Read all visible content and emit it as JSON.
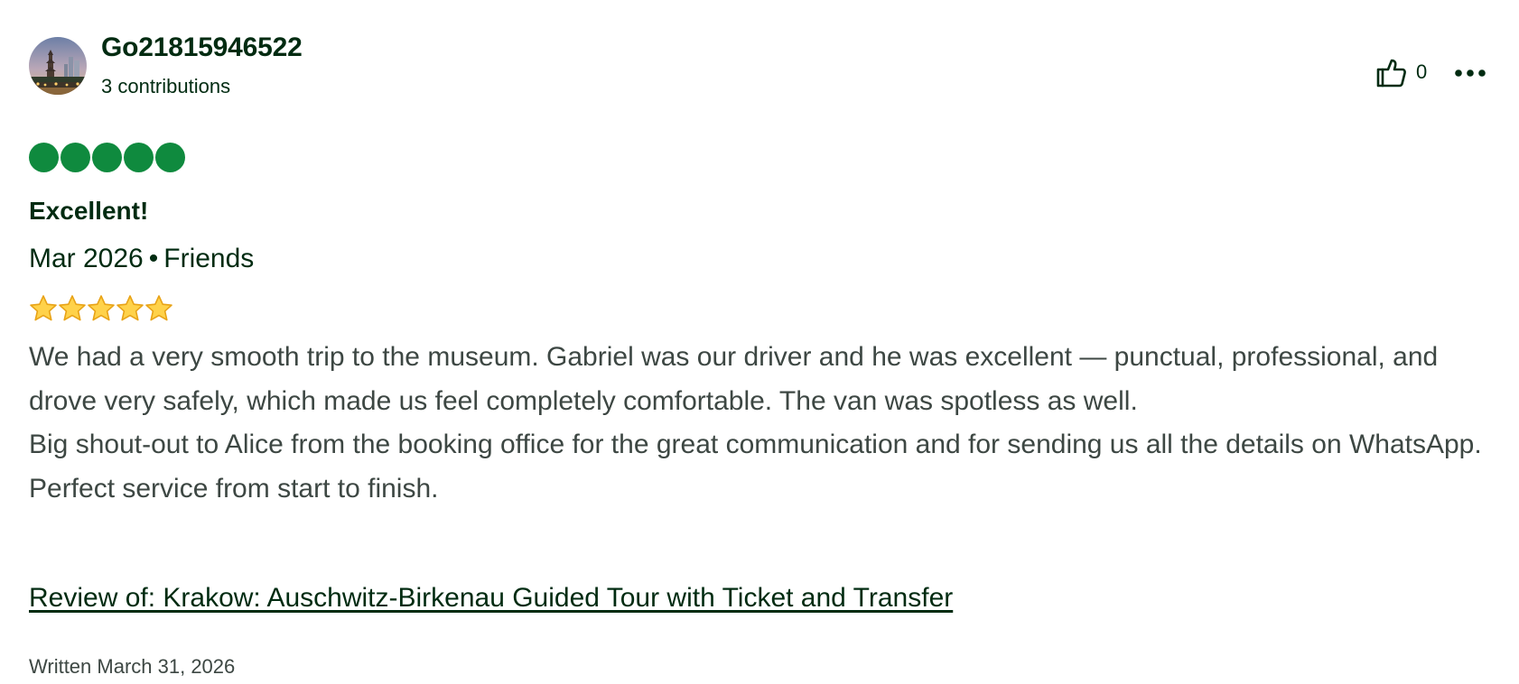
{
  "reviewer": {
    "username": "Go21815946522",
    "contributions": "3 contributions",
    "avatar": "avatar-photo-pagoda-skyline"
  },
  "actions": {
    "helpful_count": "0",
    "helpful_icon": "thumbs-up-icon",
    "more_icon": "more-options-icon"
  },
  "rating": {
    "bubbles": 5,
    "max": 5,
    "bubble_color": "#0f8a3e"
  },
  "review": {
    "title": "Excellent!",
    "date": "Mar 2026",
    "separator": "•",
    "trip_type": "Friends",
    "star_emoji_count": 5,
    "body_lines": [
      "We had a very smooth trip to the museum. Gabriel was our driver and he was excellent — punctual, professional, and drove very safely, which made us feel completely comfortable. The van was spotless as well.",
      "Big shout-out to Alice from the booking office for the great communication and for sending us all the details on WhatsApp.",
      "Perfect service from start to finish."
    ],
    "review_of": "Review of: Krakow: Auschwitz-Birkenau Guided Tour with Ticket and Transfer",
    "written": "Written March 31, 2026"
  },
  "colors": {
    "text_dark": "#002b11",
    "text_body": "#3d4743",
    "star_fill": "#ffd24a",
    "star_stroke": "#e8a317"
  }
}
